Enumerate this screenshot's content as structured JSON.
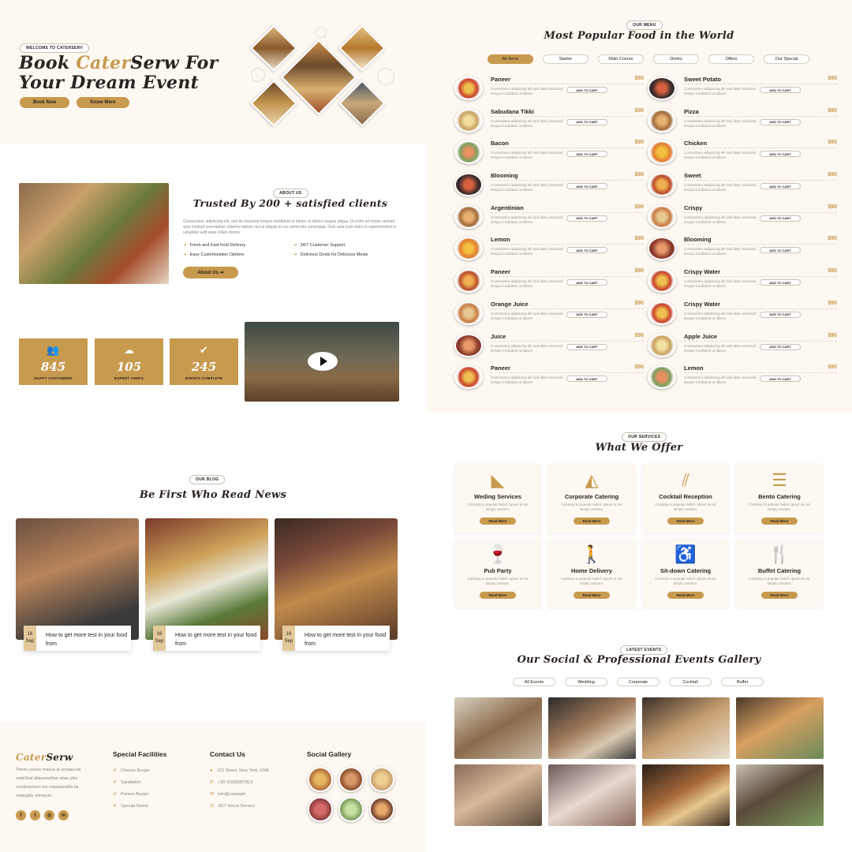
{
  "colors": {
    "accent": "#c79a4d",
    "cream": "#fdf8f1"
  },
  "hero": {
    "tag": "WELCOME TO CATERSERV",
    "title_pre": "Book ",
    "title_brand": "Cater",
    "title_post": "Serw For Your Dream Event",
    "book_now": "Book Now",
    "know_more": "Know More"
  },
  "about": {
    "tag": "ABOUT US",
    "title": "Trusted By 200 + satisfied clients",
    "description": "Consectetur adipiscing elit, sed do eiusmod tempor incididunt ut labore et dolore magna aliqua. Ut enim ad minim veniam, quis nostrud exercitation ullamco laboris nisi ut aliquip ex ea commodo consequat. Duis aute irure dolor in reprehenderit in voluptate velit esse cillum dolore.",
    "features": [
      "Fresh and Fast food Delivery",
      "24/7 Customer Support",
      "Easy Customization Options",
      "Delicious Deals for Delicious Meals"
    ],
    "button": "About Us"
  },
  "stats": [
    {
      "icon": "people-icon",
      "value": "845",
      "label": "HAPPY CUSTOMERS"
    },
    {
      "icon": "chef-icon",
      "value": "105",
      "label": "EXPERT CHEFS"
    },
    {
      "icon": "check-icon",
      "value": "245",
      "label": "EVENTS COMPLETE"
    }
  ],
  "menu": {
    "tag": "OUR MENU",
    "title": "Most Popular Food in the World",
    "tabs": [
      "All Items",
      "Starter",
      "Main Course",
      "Drinks",
      "Offers",
      "Our Special"
    ],
    "cart_label": "ADD TO CART",
    "description": "Consectetur adipiscing elit sed dwso eiusmod tempor incididunt ut labore.",
    "left": [
      {
        "name": "Paneer",
        "price": "$90"
      },
      {
        "name": "Sabudana Tikki",
        "price": "$90"
      },
      {
        "name": "Bacon",
        "price": "$90"
      },
      {
        "name": "Blooming",
        "price": "$90"
      },
      {
        "name": "Argentinian",
        "price": "$90"
      },
      {
        "name": "Lemon",
        "price": "$90"
      },
      {
        "name": "Paneer",
        "price": "$90"
      },
      {
        "name": "Orange Juice",
        "price": "$90"
      },
      {
        "name": "Juice",
        "price": "$90"
      },
      {
        "name": "Paneer",
        "price": "$90"
      }
    ],
    "right": [
      {
        "name": "Sweet Potato",
        "price": "$90"
      },
      {
        "name": "Pizza",
        "price": "$90"
      },
      {
        "name": "Chicken",
        "price": "$90"
      },
      {
        "name": "Sweet",
        "price": "$90"
      },
      {
        "name": "Crispy",
        "price": "$90"
      },
      {
        "name": "Blooming",
        "price": "$90"
      },
      {
        "name": "Crispy Water",
        "price": "$90"
      },
      {
        "name": "Crispy Water",
        "price": "$90"
      },
      {
        "name": "Apple Juice",
        "price": "$90"
      },
      {
        "name": "Lemon",
        "price": "$90"
      }
    ]
  },
  "blog": {
    "tag": "OUR BLOG",
    "title": "Be First Who Read News",
    "posts": [
      {
        "day": "16",
        "month": "Sep",
        "title": "How to get more test in your food from"
      },
      {
        "day": "16",
        "month": "Sep",
        "title": "How to get more test in your food from"
      },
      {
        "day": "16",
        "month": "Sep",
        "title": "How to get more test in your food from"
      }
    ]
  },
  "services": {
    "tag": "OUR SERVICES",
    "title": "What We Offer",
    "description": "Contrary to popular belief, Ipsum is not simply random.",
    "read_more": "Read More",
    "items": [
      {
        "icon": "cake-icon",
        "title": "Weding Services"
      },
      {
        "icon": "pizza-icon",
        "title": "Corporate Catering"
      },
      {
        "icon": "hotdog-icon",
        "title": "Cocktail Reception"
      },
      {
        "icon": "burger-icon",
        "title": "Bento Catering"
      },
      {
        "icon": "wine-glass-icon",
        "title": "Pub Party"
      },
      {
        "icon": "walking-icon",
        "title": "Home Delivery"
      },
      {
        "icon": "wheelchair-icon",
        "title": "Sit-down Catering"
      },
      {
        "icon": "cutlery-icon",
        "title": "Buffet Catering"
      }
    ]
  },
  "gallery": {
    "tag": "LATEST EVENTS",
    "title": "Our Social & Professional Events Gallery",
    "tabs": [
      "All Events",
      "Wedding",
      "Corporate",
      "Cocktail",
      "Buffet"
    ]
  },
  "footer": {
    "brand_pre": "Cater",
    "brand_post": "Serw",
    "description": "There cursus massa at urnaaculis estieSed aliquamellus vitae ultrs condmentum leo massamollis its estiegittis miristum.",
    "facilities_title": "Special Facilities",
    "facilities": [
      "Cheese Burger",
      "Sandwitch",
      "Paneer Burger",
      "Special Sweet"
    ],
    "contact_title": "Contact Us",
    "contact": [
      "123 Street, New York, USA",
      "+20 01095987813",
      "info@example",
      "26/7 Hours Service"
    ],
    "gallery_title": "Social Gallery",
    "social": [
      "f",
      "t",
      "in"
    ]
  }
}
